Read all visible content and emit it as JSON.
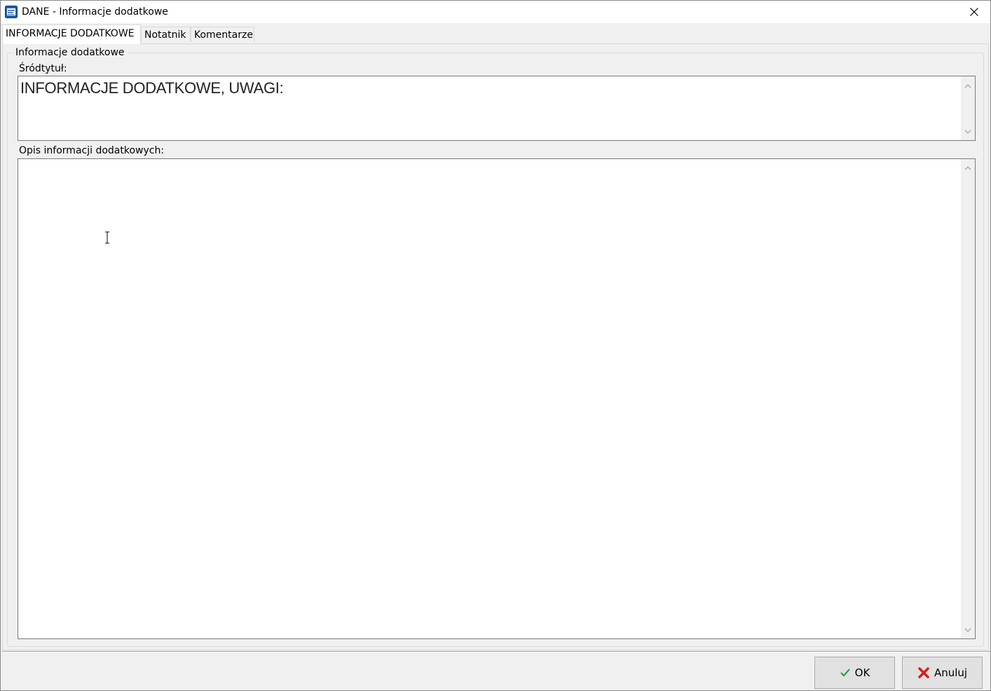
{
  "window": {
    "title": "DANE - Informacje dodatkowe"
  },
  "tabs": [
    {
      "label": "INFORMACJE DODATKOWE",
      "active": true
    },
    {
      "label": "Notatnik",
      "active": false
    },
    {
      "label": "Komentarze",
      "active": false
    }
  ],
  "group": {
    "title": "Informacje dodatkowe"
  },
  "subtitle": {
    "label": "Śródtytuł:",
    "value": "INFORMACJE DODATKOWE, UWAGI:"
  },
  "description": {
    "label": "Opis informacji dodatkowych:",
    "value": ""
  },
  "buttons": {
    "ok_label": "OK",
    "cancel_label": "Anuluj"
  },
  "colors": {
    "ok_check": "#2e9e3a",
    "cancel_x": "#d81e1e"
  },
  "icons": {
    "app": "app-document-icon",
    "close": "close-icon",
    "ok": "checkmark-icon",
    "cancel": "red-x-icon"
  }
}
